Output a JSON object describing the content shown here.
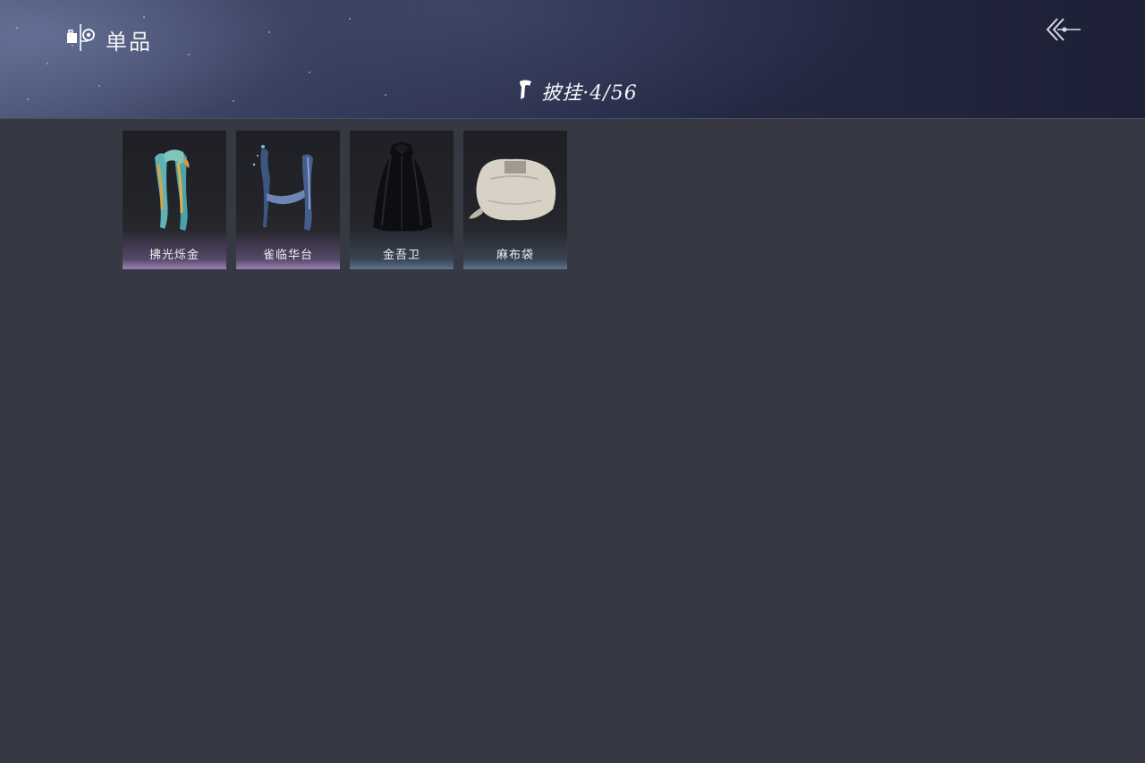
{
  "header": {
    "title": "单品",
    "category_label": "披挂·4/56"
  },
  "icons": {
    "title_icon": "wardrobe-icon",
    "category_icon": "cape-icon",
    "back_icon": "back-arrow-icon"
  },
  "colors": {
    "background": "#363943",
    "rare_purple": "#b89bd6",
    "common_blue": "#7f9bbd"
  },
  "items": [
    {
      "name": "拂光烁金",
      "rarity": "purple"
    },
    {
      "name": "雀临华台",
      "rarity": "purple"
    },
    {
      "name": "金吾卫",
      "rarity": "blue"
    },
    {
      "name": "麻布袋",
      "rarity": "blue"
    }
  ]
}
